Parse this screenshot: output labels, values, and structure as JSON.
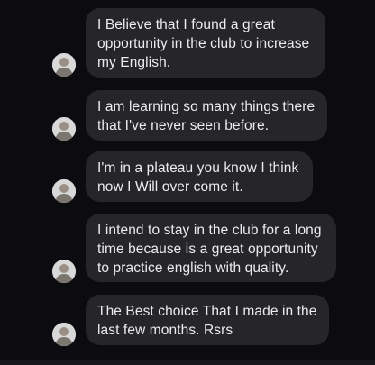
{
  "conversation": {
    "messages": [
      {
        "lines": [
          "I Believe that I found a great",
          "opportunity in the club to increase",
          "my English."
        ],
        "avatar": "person-avatar"
      },
      {
        "lines": [
          "I am learning so many things there",
          "that I've never seen before."
        ],
        "avatar": "person-avatar"
      },
      {
        "lines": [
          "I'm in a plateau you know I think",
          "now I Will over come it."
        ],
        "avatar": "person-avatar"
      },
      {
        "lines": [
          "I intend to stay in the club for a long",
          "time because is a great opportunity",
          "to practice english with quality."
        ],
        "avatar": "person-avatar"
      },
      {
        "lines": [
          "The Best choice That I made in the",
          "last few months. Rsrs"
        ],
        "avatar": "person-avatar"
      }
    ]
  },
  "colors": {
    "background": "#0b0b10",
    "bubble": "#26262a",
    "text": "#ececec"
  }
}
